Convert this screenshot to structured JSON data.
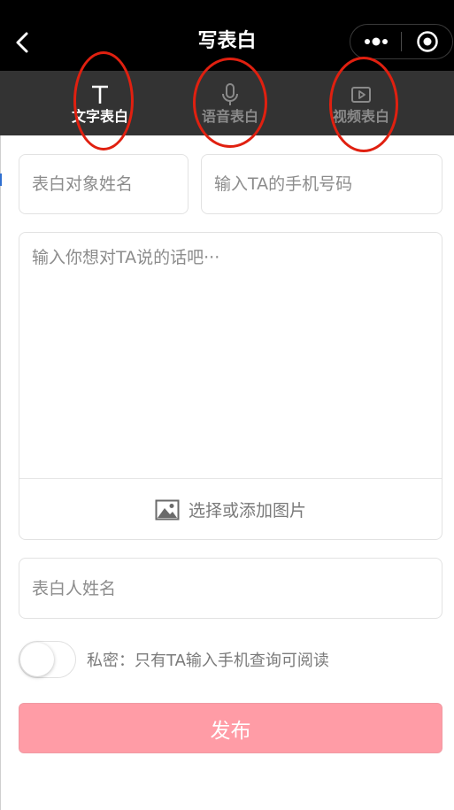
{
  "nav": {
    "title": "写表白",
    "back_icon": "chevron-left-icon",
    "more_icon": "more-dots-icon",
    "close_icon": "target-close-icon"
  },
  "tabs": [
    {
      "label": "文字表白",
      "icon": "text-t-icon",
      "active": true
    },
    {
      "label": "语音表白",
      "icon": "microphone-icon",
      "active": false
    },
    {
      "label": "视频表白",
      "icon": "video-play-icon",
      "active": false
    }
  ],
  "form": {
    "recipient_name_placeholder": "表白对象姓名",
    "recipient_phone_placeholder": "输入TA的手机号码",
    "message_placeholder": "输入你想对TA说的话吧···",
    "add_image_label": "选择或添加图片",
    "add_image_icon": "image-icon",
    "sender_name_placeholder": "表白人姓名",
    "privacy_label": "私密：只有TA输入手机查询可阅读",
    "privacy_enabled": false
  },
  "publish_label": "发布",
  "colors": {
    "nav_bg": "#000000",
    "tab_bg": "#333333",
    "publish_bg": "#ff9ca6",
    "annotation_red": "#e02010"
  }
}
